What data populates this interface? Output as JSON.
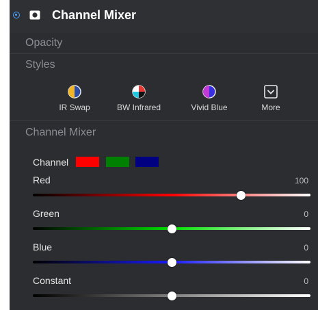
{
  "header": {
    "title": "Channel Mixer"
  },
  "sections": {
    "opacity": "Opacity",
    "styles": "Styles",
    "channel_mixer": "Channel Mixer"
  },
  "styles": [
    {
      "label": "IR Swap",
      "icon": "ir-swap-icon"
    },
    {
      "label": "BW Infrared",
      "icon": "bw-infrared-icon"
    },
    {
      "label": "Vivid Blue",
      "icon": "vivid-blue-icon"
    },
    {
      "label": "More",
      "icon": "chevron-down-icon"
    }
  ],
  "channel": {
    "label": "Channel",
    "options": [
      {
        "name": "red",
        "color": "#ff0000"
      },
      {
        "name": "green",
        "color": "#008000"
      },
      {
        "name": "blue",
        "color": "#000080"
      }
    ]
  },
  "sliders": [
    {
      "label": "Red",
      "value": "100",
      "fraction": 0.75
    },
    {
      "label": "Green",
      "value": "0",
      "fraction": 0.5
    },
    {
      "label": "Blue",
      "value": "0",
      "fraction": 0.5
    },
    {
      "label": "Constant",
      "value": "0",
      "fraction": 0.5
    }
  ],
  "colors": {
    "accent": "#4aa3ff",
    "panel": "#2b2d30"
  }
}
